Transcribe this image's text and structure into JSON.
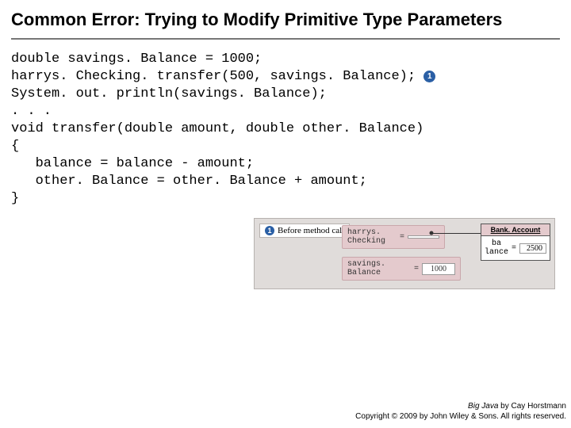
{
  "title": "Common Error: Trying to Modify Primitive Type Parameters",
  "code_lines": [
    "double savings. Balance = 1000;",
    "harrys. Checking. transfer(500, savings. Balance);",
    "System. out. println(savings. Balance);",
    ". . .",
    "void transfer(double amount, double other. Balance)",
    "{",
    "   balance = balance - amount;",
    "   other. Balance = other. Balance + amount;",
    "}"
  ],
  "badge_after_line_idx": 1,
  "badge_label": "1",
  "diagram": {
    "stage_label": "Before method call",
    "stage_badge": "1",
    "var1_name": "harrys. Checking",
    "var2_name": "savings. Balance",
    "var2_value": "1000",
    "object_type": "Bank. Account",
    "object_field": "ba lance",
    "object_value": "2500"
  },
  "footer": {
    "book": "Big Java",
    "byline": " by Cay Horstmann",
    "copyright": "Copyright © 2009 by John Wiley & Sons. All rights reserved."
  }
}
